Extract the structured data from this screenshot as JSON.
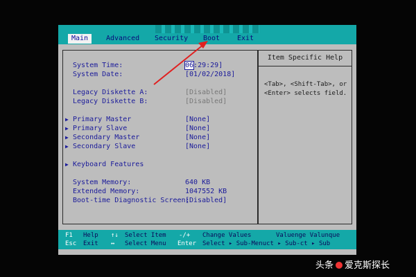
{
  "menu": {
    "items": [
      {
        "label": "Main",
        "active": true
      },
      {
        "label": "Advanced",
        "active": false
      },
      {
        "label": "Security",
        "active": false
      },
      {
        "label": "Boot",
        "active": false
      },
      {
        "label": "Exit",
        "active": false
      }
    ]
  },
  "main": {
    "system_time_label": "System Time:",
    "system_time_hour": "06",
    "system_time_rest": ":29:29]",
    "system_date_label": "System Date:",
    "system_date_value": "[01/02/2018]",
    "legacy_a_label": "Legacy Diskette A:",
    "legacy_a_value": "[Disabled]",
    "legacy_b_label": "Legacy Diskette B:",
    "legacy_b_value": "[Disabled]",
    "primary_master_label": "Primary Master",
    "primary_master_value": "[None]",
    "primary_slave_label": "Primary Slave",
    "primary_slave_value": "[None]",
    "secondary_master_label": "Secondary Master",
    "secondary_master_value": "[None]",
    "secondary_slave_label": "Secondary Slave",
    "secondary_slave_value": "[None]",
    "keyboard_label": "Keyboard Features",
    "system_memory_label": "System Memory:",
    "system_memory_value": "640 KB",
    "extended_memory_label": "Extended Memory:",
    "extended_memory_value": "1047552 KB",
    "diag_label": "Boot-time Diagnostic Screen:",
    "diag_value": "[Disabled]"
  },
  "help": {
    "title": "Item Specific Help",
    "line1": "<Tab>, <Shift-Tab>, or",
    "line2": "<Enter> selects field."
  },
  "keys": {
    "r1": [
      {
        "key": "F1",
        "desc": "Help"
      },
      {
        "key": "↑↓",
        "desc": "Select Item"
      },
      {
        "key": "-/+",
        "desc": "Change Values"
      },
      {
        "key": "",
        "desc": "Valuenge Valunque"
      }
    ],
    "r2": [
      {
        "key": "Esc",
        "desc": "Exit"
      },
      {
        "key": "↔",
        "desc": "Select Menu"
      },
      {
        "key": "Enter",
        "desc": "Select ▸ Sub-Menuct ▸ Sub-ct ▸ Sub"
      }
    ]
  },
  "watermark": {
    "left": "头条",
    "right": "爱克斯探长"
  },
  "colors": {
    "bios_grey": "#bdbdbd",
    "bar_cyan": "#14a8a8",
    "text_blue": "#1a1a9a",
    "arrow_red": "#e02020"
  }
}
